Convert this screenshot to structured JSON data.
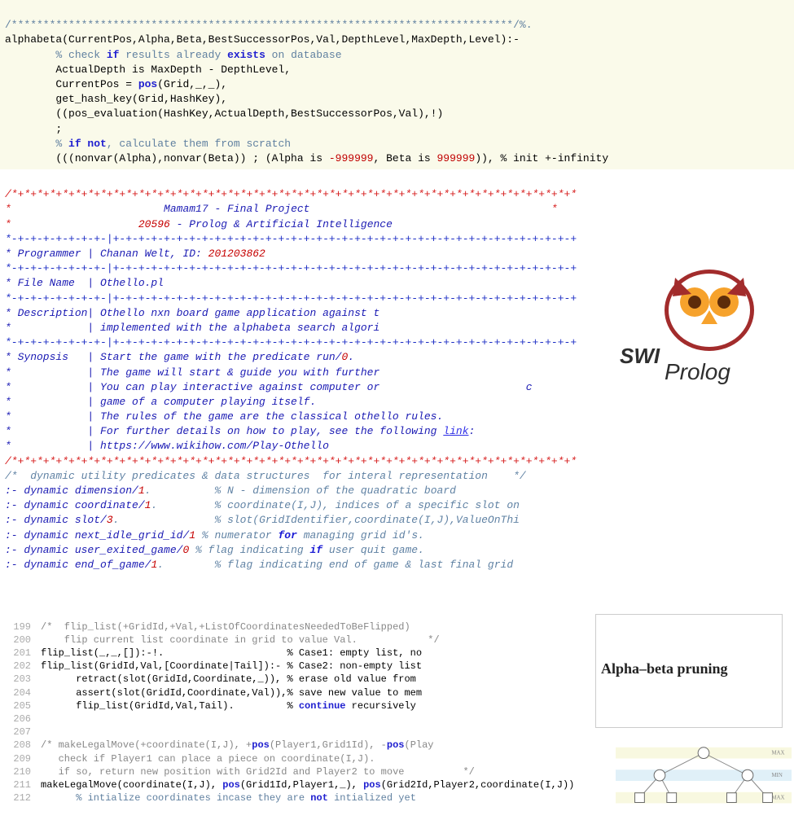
{
  "panel1": {
    "line1_stars": "/*******************************************************************************/%.",
    "line2_pre": "alphabeta(CurrentPos,Alpha,Beta,BestSuccessorPos,Val,DepthLevel,MaxDepth,Level):-",
    "line3_cmt": "        % check if results already exists on database",
    "line4": "        ActualDepth is MaxDepth - DepthLevel,",
    "line5a": "        CurrentPos = ",
    "line5b": "pos",
    "line5c": "(Grid,_,_),",
    "line6": "        get_hash_key(Grid,HashKey),",
    "line7": "        ((pos_evaluation(HashKey,ActualDepth,BestSuccessorPos,Val),!)",
    "line8": "        ;",
    "line9_cmt": "        % if not, calculate them from scratch",
    "line10a": "        (((nonvar(Alpha),nonvar(Beta)) ; (Alpha is ",
    "line10b": "-999999",
    "line10c": ", Beta is ",
    "line10d": "999999",
    "line10e": ")), % init +-infinity"
  },
  "panel2": {
    "border": "/*+*+*+*+*+*+*+*+*+*+*+*+*+*+*+*+*+*+*+*+*+*+*+*+*+*+*+*+*+*+*+*+*+*+*+*+*+*+*+*+*+*+*+*+*",
    "title1": "                        Mamam17 - Final Project                                      ",
    "title2a": "                    ",
    "title2_num": "20596",
    "title2b": " - Prolog & Artificial Intelligence",
    "sep": "*-+-+-+-+-+-+-+-|+-+-+-+-+-+-+-+-+-+-+-+-+-+-+-+-+-+-+-+-+-+-+-+-+-+-+-+-+-+-+-+-+-+-+-+-+",
    "prog_label": "* Programmer | Chanan Welt, ID: ",
    "prog_id": "201203862",
    "file_label": "* File Name  | Othello.pl",
    "desc_label": "* Description| Othello nxn board game application against t",
    "desc2": "*            | implemented with the alphabeta search algori",
    "syn_label": "* Synopsis   | Start the game with the predicate run/",
    "syn_label_num": "0",
    "syn2": "*            | The game will start & guide you with further",
    "syn3": "*            | You can play interactive against computer or                       c",
    "syn4": "*            | game of a computer playing itself.",
    "syn5": "*            | The rules of the game are the classical othello rules.",
    "syn6": "*            | For further details on how to play, see the following ",
    "syn6_link": "link",
    "syn7": "*            | https://www.wikihow.com/Play-Othello",
    "dyn_cmt": "/*  dynamic utility predicates & data structures  for interal representation    */",
    "d1a": ":- dynamic dimension/",
    "d1n": "1",
    "d1c": ".          % N - dimension of the quadratic board",
    "d2a": ":- dynamic coordinate/",
    "d2n": "1",
    "d2c": ".         % coordinate(I,J), indices of a specific slot on",
    "d3a": ":- dynamic slot/",
    "d3n": "3",
    "d3c": ".               % slot(GridIdentifier,coordinate(I,J),ValueOnThi",
    "d4a": ":- dynamic next_idle_grid_id/",
    "d4n": "1",
    "d4c": ".  % numerator for managing grid id's.",
    "d5a": ":- dynamic user_exited_game/",
    "d5n": "0",
    "d5c": ".   % flag indicating if user quit game.",
    "d6a": ":- dynamic end_of_game/",
    "d6n": "1",
    "d6c": ".        % flag indicating end of game & last final grid",
    "logo_text": "SWI Prolog"
  },
  "panel3": {
    "lines": [
      {
        "n": "199",
        "t": "/*  flip_list(+GridId,+Val,+ListOfCoordinatesNeededToBeFlipped)",
        "cls": "cmt"
      },
      {
        "n": "200",
        "t": "    flip current list coordinate in grid to value Val.            */",
        "cls": "cmt"
      },
      {
        "n": "201",
        "t": "flip_list(_,_,[]):-!.                     % Case1: empty list, no",
        "cls": "plain"
      },
      {
        "n": "202",
        "t": "flip_list(GridId,Val,[Coordinate|Tail]):- % Case2: non-empty list",
        "cls": "plain"
      },
      {
        "n": "203",
        "t": "      retract(slot(GridId,Coordinate,_)), % erase old value from",
        "cls": "plain"
      },
      {
        "n": "204",
        "t": "      assert(slot(GridId,Coordinate,Val)),% save new value to mem",
        "cls": "plain"
      },
      {
        "n": "205",
        "t": "      flip_list(GridId,Val,Tail).         % continue recursively",
        "cls": "plain"
      },
      {
        "n": "206",
        "t": " ",
        "cls": "plain"
      },
      {
        "n": "207",
        "t": " ",
        "cls": "plain"
      },
      {
        "n": "208",
        "t": "/* makeLegalMove(+coordinate(I,J), +pos(Player1,Grid1Id), -pos(Play",
        "cls": "cmt"
      },
      {
        "n": "209",
        "t": "   check if Player1 can place a piece on coordinate(I,J).",
        "cls": "cmt"
      },
      {
        "n": "210",
        "t": "   if so, return new position with Grid2Id and Player2 to move          */",
        "cls": "cmt"
      },
      {
        "n": "211",
        "t": "makeLegalMove(coordinate(I,J), pos(Grid1Id,Player1,_), pos(Grid2Id,Player2,coordinate(I,J))",
        "cls": "plain"
      },
      {
        "n": "212",
        "t": "      % intialize coordinates incase they are not intialized yet",
        "cls": "cmt2"
      }
    ],
    "ab_title": "Alpha–beta pruning"
  }
}
